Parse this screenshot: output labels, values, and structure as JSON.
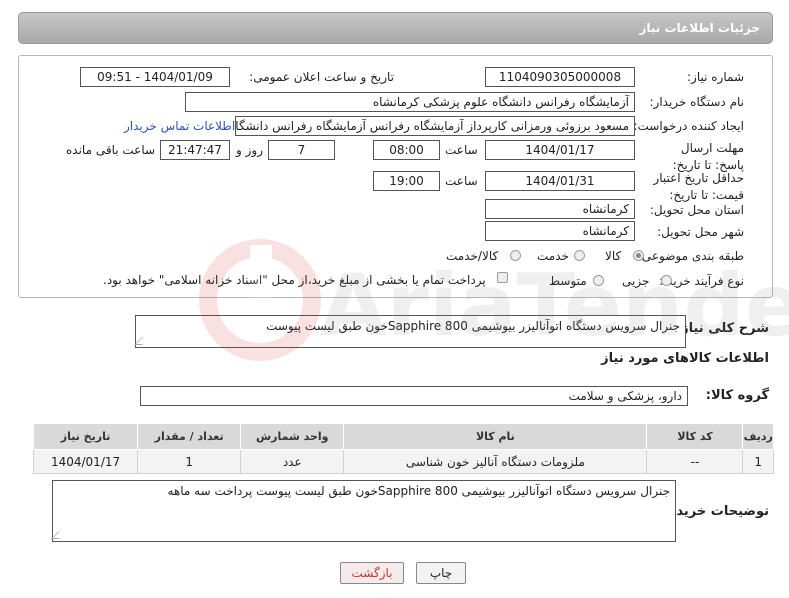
{
  "header": {
    "title": "جزئیات اطلاعات نیاز"
  },
  "form": {
    "need_number_label": "شماره نیاز:",
    "need_number_value": "1104090305000008",
    "announce_label": "تاریخ و ساعت اعلان عمومی:",
    "announce_value": "1404/01/09 - 09:51",
    "buyer_org_label": "نام دستگاه خریدار:",
    "buyer_org_value": "آزمایشگاه رفرانس دانشگاه علوم پزشکی کرمانشاه",
    "creator_label": "ایجاد کننده درخواست:",
    "creator_value": "مسعود برزوئی ورمزانی کارپرداز آزمایشگاه رفرانس آزمایشگاه رفرانس دانشگاه ع",
    "contact_link": "اطلاعات تماس خریدار",
    "deadline_label": "مهلت ارسال پاسخ: تا تاریخ:",
    "deadline_date": "1404/01/17",
    "time_label": "ساعت",
    "deadline_time": "08:00",
    "days_value": "7",
    "days_label": "روز و",
    "remaining_value": "21:47:47",
    "remaining_label": "ساعت باقی مانده",
    "validity_label": "حداقل تاریخ اعتبار قیمت: تا تاریخ:",
    "validity_date": "1404/01/31",
    "validity_time": "19:00",
    "province_label": "استان محل تحویل:",
    "province_value": "کرمانشاه",
    "city_label": "شهر محل تحویل:",
    "city_value": "کرمانشاه",
    "category_label": "طبقه بندی موضوعی:",
    "category_options": [
      "کالا",
      "خدمت",
      "کالا/خدمت"
    ],
    "category_selected": "کالا",
    "purchase_label": "نوع فرآیند خرید :",
    "purchase_options": [
      "جزیی",
      "متوسط"
    ],
    "payment_note": "پرداخت تمام یا بخشی از مبلغ خرید،از محل \"اسناد خزانه اسلامی\" خواهد بود."
  },
  "summary": {
    "label": "شرح کلی نیاز:",
    "value": "جنرال سرویس دستگاه اتوآنالیزر بیوشیمی Sapphire 800خون طبق لیست پیوست"
  },
  "goods": {
    "section_title": "اطلاعات کالاهای مورد نیاز",
    "group_label": "گروه کالا:",
    "group_value": "دارو، پزشکی و سلامت",
    "columns": [
      "ردیف",
      "کد کالا",
      "نام کالا",
      "واحد شمارش",
      "تعداد / مقدار",
      "تاریخ نیاز"
    ],
    "rows": [
      [
        "1",
        "--",
        "ملزومات دستگاه آنالیز خون شناسی",
        "عدد",
        "1",
        "1404/01/17"
      ]
    ]
  },
  "buyer_notes": {
    "label": "توضیحات خریدار:",
    "value": "جنرال سرویس دستگاه اتوآنالیزر بیوشیمی Sapphire 800خون طبق لیست پیوست پرداخت سه ماهه"
  },
  "buttons": {
    "print": "چاپ",
    "back": "بازگشت"
  },
  "watermark": "AriaTender.neT"
}
